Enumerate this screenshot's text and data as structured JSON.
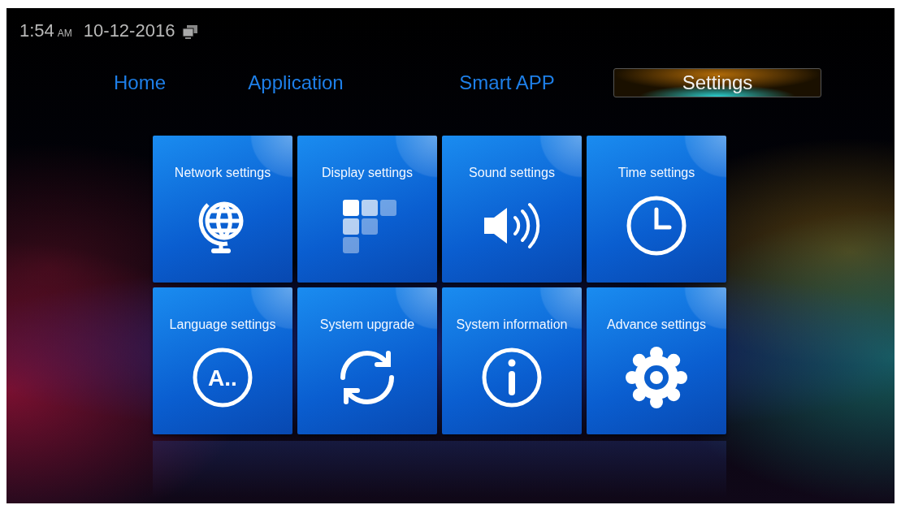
{
  "status_bar": {
    "time": "1:54",
    "meridiem": "AM",
    "date": "10-12-2016"
  },
  "tabs": [
    {
      "label": "Home",
      "selected": false
    },
    {
      "label": "Application",
      "selected": false
    },
    {
      "label": "Smart APP",
      "selected": false
    },
    {
      "label": "Settings",
      "selected": true
    }
  ],
  "tiles": [
    {
      "label": "Network settings",
      "kind": "globe"
    },
    {
      "label": "Display settings",
      "kind": "squares"
    },
    {
      "label": "Sound settings",
      "kind": "speaker"
    },
    {
      "label": "Time settings",
      "kind": "clock"
    },
    {
      "label": "Language settings",
      "kind": "letter",
      "icon_text": "A.."
    },
    {
      "label": "System upgrade",
      "kind": "sync"
    },
    {
      "label": "System information",
      "kind": "info"
    },
    {
      "label": "Advance settings",
      "kind": "gear"
    }
  ]
}
